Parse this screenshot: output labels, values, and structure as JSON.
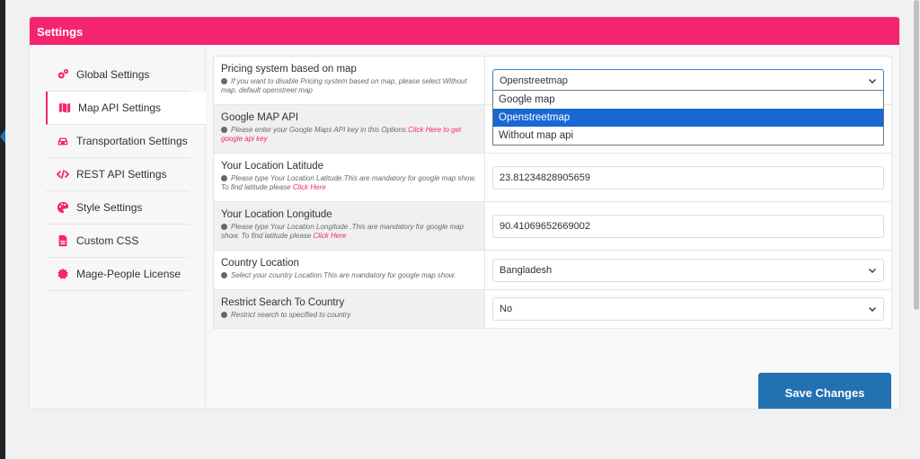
{
  "header": {
    "title": "Settings"
  },
  "sidebar": {
    "items": [
      {
        "label": "Global Settings",
        "icon": "gears-icon"
      },
      {
        "label": "Map API Settings",
        "icon": "map-icon",
        "active": true
      },
      {
        "label": "Transportation Settings",
        "icon": "car-icon"
      },
      {
        "label": "REST API Settings",
        "icon": "code-icon"
      },
      {
        "label": "Style Settings",
        "icon": "palette-icon"
      },
      {
        "label": "Custom CSS",
        "icon": "css-file-icon"
      },
      {
        "label": "Mage-People License",
        "icon": "badge-icon"
      }
    ]
  },
  "fields": {
    "pricing": {
      "title": "Pricing system based on map",
      "desc": "If you want to disable Pricing system based on map, please select Without map. default openstreet map",
      "value": "Openstreetmap",
      "options": [
        "Google map",
        "Openstreetmap",
        "Without map api"
      ]
    },
    "gmap_api": {
      "title": "Google MAP API",
      "desc": "Please enter your Google Maps API key in this Options.",
      "link": "Click Here to get google api key"
    },
    "latitude": {
      "title": "Your Location Latitude",
      "desc": "Please type Your Location Latitude.This are mandatory for google map show. To find latitude please",
      "link": "Click Here",
      "value": "23.81234828905659"
    },
    "longitude": {
      "title": "Your Location Longitude",
      "desc": "Please type Your Location Longitude .This are mandatory for google map show. To find latitude please",
      "link": "Click Here",
      "value": "90.41069652669002"
    },
    "country": {
      "title": "Country Location",
      "desc": "Select your country Location.This are mandatory for google map show.",
      "value": "Bangladesh"
    },
    "restrict": {
      "title": "Restrict Search To Country",
      "desc": "Restrict search to specified to country",
      "value": "No"
    }
  },
  "actions": {
    "save_label": "Save Changes"
  },
  "colors": {
    "accent": "#f5246e",
    "primary": "#2271b1",
    "selected_option": "#1967d2"
  }
}
